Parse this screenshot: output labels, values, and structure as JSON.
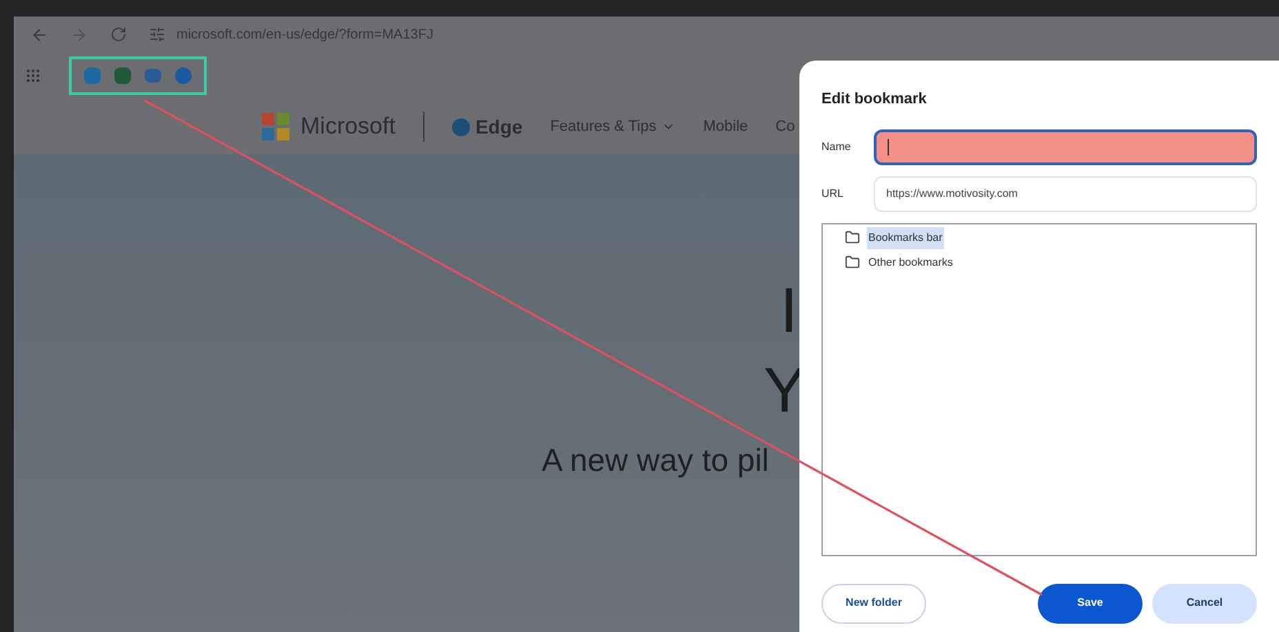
{
  "browser": {
    "url": "microsoft.com/en-us/edge/?form=MA13FJ"
  },
  "page": {
    "nav": {
      "brand": "Microsoft",
      "product": "Edge",
      "links": [
        {
          "label": "Features & Tips",
          "has_menu": true
        },
        {
          "label": "Mobile",
          "has_menu": false
        },
        {
          "label": "Co",
          "has_menu": false
        }
      ]
    },
    "hero": {
      "heading_lines": [
        "I",
        "Y"
      ],
      "subtitle": "A new way to pil"
    }
  },
  "dialog": {
    "title": "Edit bookmark",
    "fields": [
      {
        "label": "Name",
        "highlighted": true
      },
      {
        "label": "URL",
        "value": "https://www.motivosity.com",
        "highlighted": false
      }
    ],
    "folders": [
      {
        "label": "Bookmarks bar",
        "selected": true
      },
      {
        "label": "Other bookmarks",
        "selected": false
      }
    ],
    "buttons": [
      {
        "label": "New folder",
        "kind": "outline"
      },
      {
        "label": "Save",
        "kind": "primary"
      },
      {
        "label": "Cancel",
        "kind": "secondary"
      }
    ]
  }
}
